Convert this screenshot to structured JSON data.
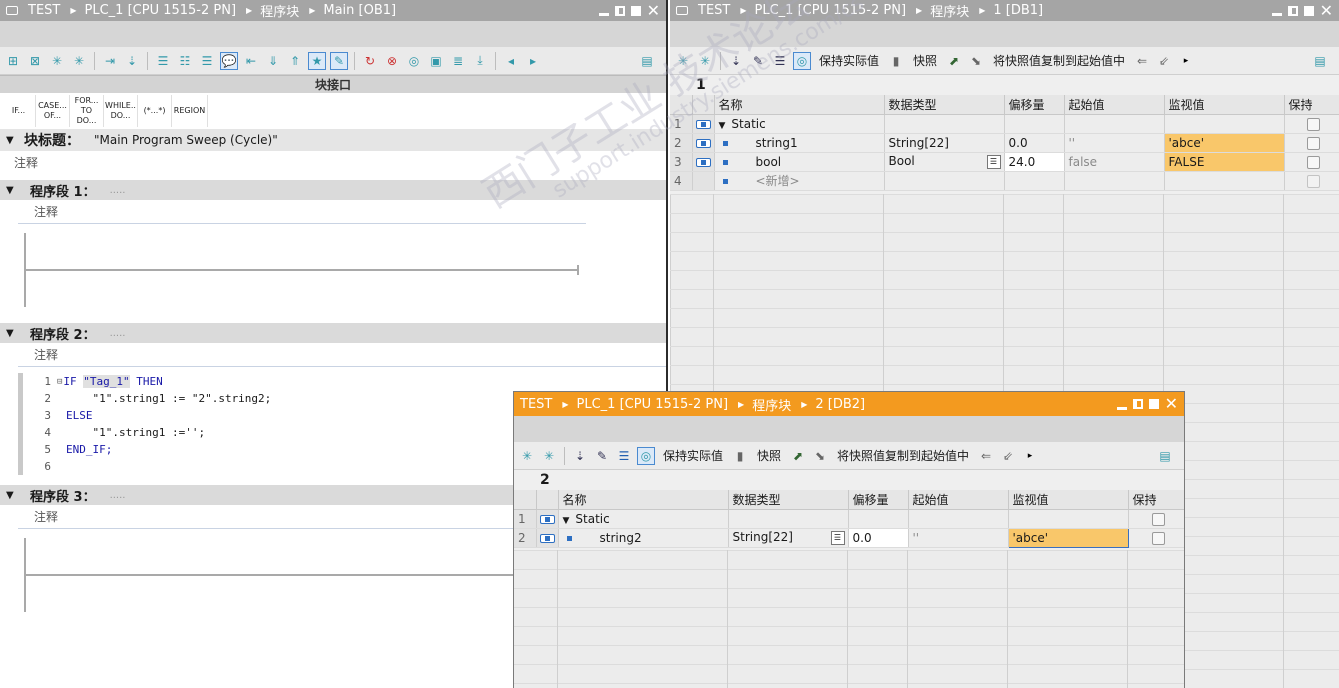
{
  "left_window": {
    "breadcrumb": [
      "TEST",
      "PLC_1 [CPU 1515-2 PN]",
      "程序块",
      "Main [OB1]"
    ],
    "block_interface_label": "块接口",
    "keywords": [
      {
        "line1": "IF...",
        "line2": ""
      },
      {
        "line1": "CASE...",
        "line2": "OF..."
      },
      {
        "line1": "FOR...",
        "line2": "TO DO..."
      },
      {
        "line1": "WHILE..",
        "line2": "DO..."
      },
      {
        "line1": "(*...*)",
        "line2": ""
      },
      {
        "line1": "REGION",
        "line2": ""
      }
    ],
    "block_title_label": "块标题：",
    "block_title_value": "\"Main Program Sweep (Cycle)\"",
    "comment_label": "注释",
    "segments": [
      {
        "title": "程序段 1：",
        "dots": ".....",
        "comment": "注释"
      },
      {
        "title": "程序段 2：",
        "dots": ".....",
        "comment": "注释"
      },
      {
        "title": "程序段 3：",
        "dots": ".....",
        "comment": "注释"
      }
    ],
    "code_lines": [
      {
        "num": "1",
        "text_pre": "IF ",
        "tag": "\"Tag_1\"",
        "text_post": " THEN"
      },
      {
        "num": "2",
        "text": "    \"1\".string1 := \"2\".string2;"
      },
      {
        "num": "3",
        "text": "ELSE"
      },
      {
        "num": "4",
        "text": "    \"1\".string1 :='';"
      },
      {
        "num": "5",
        "text": "END_IF;"
      },
      {
        "num": "6",
        "text": ""
      }
    ]
  },
  "right_window": {
    "breadcrumb": [
      "TEST",
      "PLC_1 [CPU 1515-2 PN]",
      "程序块",
      "1 [DB1]"
    ],
    "toolbar": {
      "keep_actual": "保持实际值",
      "snapshot": "快照",
      "copy_snapshot": "将快照值复制到起始值中"
    },
    "table_id": "1",
    "columns": [
      "名称",
      "数据类型",
      "偏移量",
      "起始值",
      "监视值",
      "保持"
    ],
    "rows": [
      {
        "num": "1",
        "name": "Static",
        "type": "",
        "offset": "",
        "start": "",
        "monitor": ""
      },
      {
        "num": "2",
        "name": "string1",
        "type": "String[22]",
        "offset": "0.0",
        "start": "''",
        "monitor": "'abce'"
      },
      {
        "num": "3",
        "name": "bool",
        "type": "Bool",
        "offset": "24.0",
        "start": "false",
        "monitor": "FALSE"
      },
      {
        "num": "4",
        "name": "<新增>",
        "type": "",
        "offset": "",
        "start": "",
        "monitor": ""
      }
    ]
  },
  "float_window": {
    "breadcrumb": [
      "TEST",
      "PLC_1 [CPU 1515-2 PN]",
      "程序块",
      "2 [DB2]"
    ],
    "toolbar": {
      "keep_actual": "保持实际值",
      "snapshot": "快照",
      "copy_snapshot": "将快照值复制到起始值中"
    },
    "table_id": "2",
    "columns": [
      "名称",
      "数据类型",
      "偏移量",
      "起始值",
      "监视值",
      "保持"
    ],
    "rows": [
      {
        "num": "1",
        "name": "Static",
        "type": "",
        "offset": "",
        "start": "",
        "monitor": ""
      },
      {
        "num": "2",
        "name": "string2",
        "type": "String[22]",
        "offset": "0.0",
        "start": "''",
        "monitor": "'abce'"
      }
    ]
  },
  "watermark": {
    "line1": "西门子工业 技术论坛",
    "line2": "support.industry.siemens.com/cs"
  },
  "colors": {
    "title_gray": "#a5a5a5",
    "title_orange": "#f39a1f",
    "monitor_highlight": "#f9c76a"
  }
}
